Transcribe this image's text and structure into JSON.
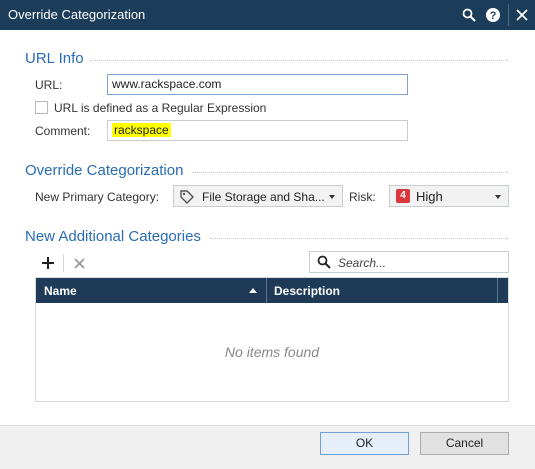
{
  "window": {
    "title": "Override Categorization",
    "icons": [
      "search-icon",
      "help-icon",
      "close-icon"
    ]
  },
  "url_info": {
    "header": "URL Info",
    "url_label": "URL:",
    "url_value": "www.rackspace.com",
    "regex_label": "URL is defined as a Regular Expression",
    "regex_checked": false,
    "comment_label": "Comment:",
    "comment_value": "rackspace"
  },
  "override": {
    "header": "Override Categorization",
    "primary_label": "New Primary Category:",
    "primary_value": "File Storage and Sha...",
    "risk_label": "Risk:",
    "risk_badge": "4",
    "risk_value": "High",
    "risk_color": "#d9373c"
  },
  "additional": {
    "header": "New Additional Categories",
    "search_placeholder": "Search...",
    "columns": [
      "Name",
      "Description"
    ],
    "empty_message": "No items found"
  },
  "footer": {
    "ok_label": "OK",
    "cancel_label": "Cancel"
  },
  "colors": {
    "titlebar": "#1c3d5a",
    "section_header": "#2a6cb3",
    "grid_header": "#1e3a56",
    "highlight": "#ffff00"
  }
}
